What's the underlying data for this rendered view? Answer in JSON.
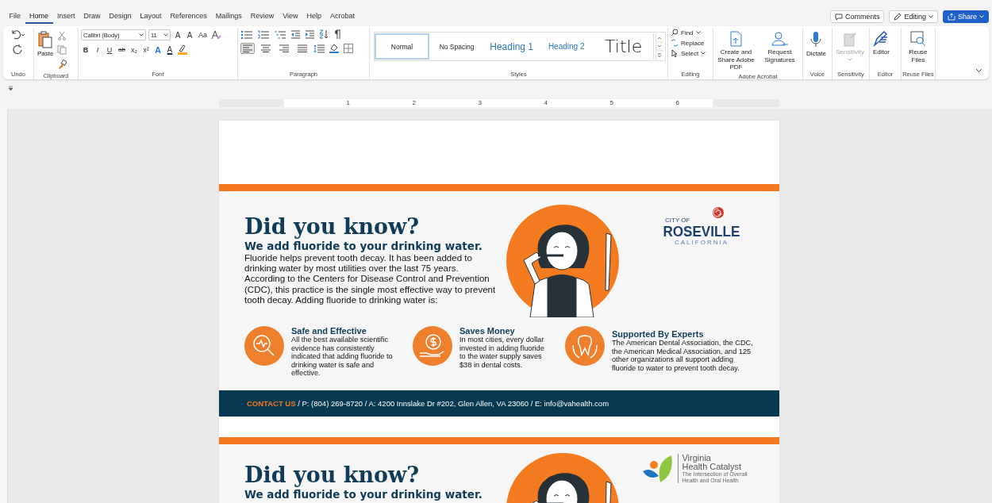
{
  "tabs": [
    {
      "label": "File",
      "selected": false
    },
    {
      "label": "Home",
      "selected": true
    },
    {
      "label": "Insert",
      "selected": false
    },
    {
      "label": "Draw",
      "selected": false
    },
    {
      "label": "Design",
      "selected": false
    },
    {
      "label": "Layout",
      "selected": false
    },
    {
      "label": "References",
      "selected": false
    },
    {
      "label": "Mailings",
      "selected": false
    },
    {
      "label": "Review",
      "selected": false
    },
    {
      "label": "View",
      "selected": false
    },
    {
      "label": "Help",
      "selected": false
    },
    {
      "label": "Acrobat",
      "selected": false
    }
  ],
  "top_buttons": {
    "comments": "Comments",
    "editing": "Editing",
    "share": "Share"
  },
  "ribbon": {
    "undo": {
      "label": "Undo"
    },
    "clipboard": {
      "label": "Clipboard",
      "paste": "Paste"
    },
    "font": {
      "label": "Font",
      "name": "Calibri (Body)",
      "size": "11",
      "row1": [
        {
          "kind": "grow",
          "label": "A"
        },
        {
          "kind": "shrink",
          "label": "A"
        },
        {
          "kind": "case",
          "label": "Aa"
        }
      ],
      "row2": [
        {
          "kind": "bold",
          "label": "B"
        },
        {
          "kind": "italic",
          "label": "I"
        },
        {
          "kind": "underline",
          "label": "U"
        },
        {
          "kind": "strike",
          "label": "ab"
        },
        {
          "kind": "sub",
          "label": "x₂"
        },
        {
          "kind": "super",
          "label": "x²"
        },
        {
          "kind": "effects",
          "label": "A"
        },
        {
          "kind": "color",
          "label": "A"
        }
      ]
    },
    "paragraph": {
      "label": "Paragraph",
      "alignment": [
        {
          "kind": "left",
          "selected": true
        },
        {
          "kind": "center",
          "selected": false
        },
        {
          "kind": "right",
          "selected": false
        },
        {
          "kind": "justify",
          "selected": false
        }
      ]
    },
    "styles": {
      "label": "Styles",
      "items": [
        {
          "kind": "normal",
          "label": "Normal",
          "selected": true
        },
        {
          "kind": "plain",
          "label": "No Spacing",
          "selected": false
        },
        {
          "kind": "heading1",
          "label": "Heading 1",
          "selected": false
        },
        {
          "kind": "heading2",
          "label": "Heading 2",
          "selected": false
        },
        {
          "kind": "title",
          "label": "Title",
          "selected": false
        }
      ]
    },
    "editing": {
      "label": "Editing",
      "find": "Find",
      "replace": "Replace",
      "select": "Select"
    },
    "acrobat": {
      "label": "Adobe Acrobat",
      "create": "Create and Share Adobe PDF",
      "request": "Request Signatures"
    },
    "voice": {
      "label": "Voice",
      "dictate": "Dictate"
    },
    "sensitivity": {
      "label": "Sensitivity",
      "button": "Sensitivity",
      "disabled": true
    },
    "editor": {
      "label": "Editor",
      "button": "Editor"
    },
    "reuse": {
      "label": "Reuse Files",
      "button": "Reuse Files"
    }
  },
  "ruler": {
    "numbers": [
      "1",
      "2",
      "3",
      "4",
      "5",
      "6"
    ]
  },
  "flyers": [
    {
      "heading": "Did you know?",
      "subheading": "We add fluoride to your drinking water.",
      "body": "Fluoride helps prevent tooth decay. It has been added to drinking water by most utilities over the last 75 years. According to the Centers for Disease Control and Prevention (CDC), this practice is the single most effective way to prevent tooth decay. Adding fluoride to drinking water is:",
      "logo": {
        "kind": "roseville",
        "line1": "CITY OF",
        "line2": "ROSEVILLE",
        "line3": "CALIFORNIA"
      },
      "features": [
        {
          "kind": "safe",
          "title": "Safe and Effective",
          "text": "All the best available scientific evidence has consistently indicated that adding fluoride to drinking water is safe and effective."
        },
        {
          "kind": "money",
          "title": "Saves Money",
          "text": "In most cities, every dollar invested in adding fluoride to the water supply saves $38 in dental costs."
        },
        {
          "kind": "experts",
          "title": "Supported By Experts",
          "text": "The American Dental Association, the CDC, the American Medical Association, and 125 other organizations all support adding fluoride to water to prevent tooth decay."
        }
      ],
      "contact": {
        "label": "CONTACT US",
        "text": " / P: (804) 269-8720 / A: 4200 Innslake Dr #202, Glen Allen, VA 23060 / E: info@vahealth.com"
      }
    },
    {
      "heading": "Did you know?",
      "subheading": "We add fluoride to your drinking water.",
      "logo": {
        "kind": "catalyst",
        "line1": "Virginia",
        "line2": "Health Catalyst",
        "line3": "The Intersection of Overall",
        "line4": "Health and Oral Health"
      }
    }
  ]
}
